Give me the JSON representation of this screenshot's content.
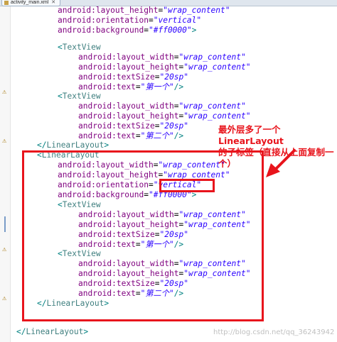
{
  "tab": {
    "title": "activity_main.xml",
    "close": "✕"
  },
  "gutter": {
    "warning_icon": "warning-icon",
    "change_marker": "change-marker"
  },
  "code": {
    "line01_attr": "android:layout_height",
    "line01_eq": "=",
    "line01_val": "\"wrap_content\"",
    "line02_attr": "android:orientation",
    "line02_eq": "=",
    "line02_val": "\"vertical\"",
    "line03_attr": "android:background",
    "line03_eq": "=",
    "line03_val": "\"#ff0000\"",
    "line03_end": ">",
    "line04_lt": "<",
    "line04_tag": "TextView",
    "line05_attr": "android:layout_width",
    "line05_eq": "=",
    "line05_val": "\"wrap_content\"",
    "line06_attr": "android:layout_height",
    "line06_eq": "=",
    "line06_val": "\"wrap_content\"",
    "line07_attr": "android:textSize",
    "line07_eq": "=",
    "line07_val": "\"20sp\"",
    "line08_attr": "android:text",
    "line08_eq": "=",
    "line08_val": "\"第一个\"",
    "line08_end": "/>",
    "line09_lt": "<",
    "line09_tag": "TextView",
    "line10_attr": "android:layout_width",
    "line10_eq": "=",
    "line10_val": "\"wrap_content\"",
    "line11_attr": "android:layout_height",
    "line11_eq": "=",
    "line11_val": "\"wrap_content\"",
    "line12_attr": "android:textSize",
    "line12_eq": "=",
    "line12_val": "\"20sp\"",
    "line13_attr": "android:text",
    "line13_eq": "=",
    "line13_val": "\"第二个\"",
    "line13_end": "/>",
    "line14_lt": "</",
    "line14_tag": "LinearLayout",
    "line14_end": ">",
    "line15_lt": "<",
    "line15_tag": "LinearLayout",
    "line16_attr": "android:layout_width",
    "line16_eq": "=",
    "line16_val": "\"wrap_content\"",
    "line17_attr": "android:layout_height",
    "line17_eq": "=",
    "line17_val": "\"wrap_content\"",
    "line18_attr": "android:orientation",
    "line18_eq": "=",
    "line18_val": "\"vertical\"",
    "line19_attr": "android:background",
    "line19_eq": "=",
    "line19_val": "\"#ff0000\"",
    "line19_end": ">",
    "line20_lt": "<",
    "line20_tag": "TextView",
    "line21_attr": "android:layout_width",
    "line21_eq": "=",
    "line21_val": "\"wrap_content\"",
    "line22_attr": "android:layout_height",
    "line22_eq": "=",
    "line22_val": "\"wrap_content\"",
    "line23_attr": "android:textSize",
    "line23_eq": "=",
    "line23_val": "\"20sp\"",
    "line24_attr": "android:text",
    "line24_eq": "=",
    "line24_val": "\"第一个\"",
    "line24_end": "/>",
    "line25_lt": "<",
    "line25_tag": "TextView",
    "line26_attr": "android:layout_width",
    "line26_eq": "=",
    "line26_val": "\"wrap_content\"",
    "line27_attr": "android:layout_height",
    "line27_eq": "=",
    "line27_val": "\"wrap_content\"",
    "line28_attr": "android:textSize",
    "line28_eq": "=",
    "line28_val": "\"20sp\"",
    "line29_attr": "android:text",
    "line29_eq": "=",
    "line29_val": "\"第二个\"",
    "line29_end": "/>",
    "line30_lt": "</",
    "line30_tag": "LinearLayout",
    "line30_end": ">",
    "line31_lt": "</",
    "line31_tag": "LinearLayout",
    "line31_end": ">"
  },
  "annotation": {
    "line1": "最外层多了一个LinearLayout",
    "line2": "的子标签（直接从上面复制一个）"
  },
  "watermark": "http://blog.csdn.net/qq_36243942",
  "colors": {
    "highlight": "#e8141c",
    "tag": "#3f7f7f",
    "attribute": "#7f007f",
    "value": "#2a00ff"
  }
}
